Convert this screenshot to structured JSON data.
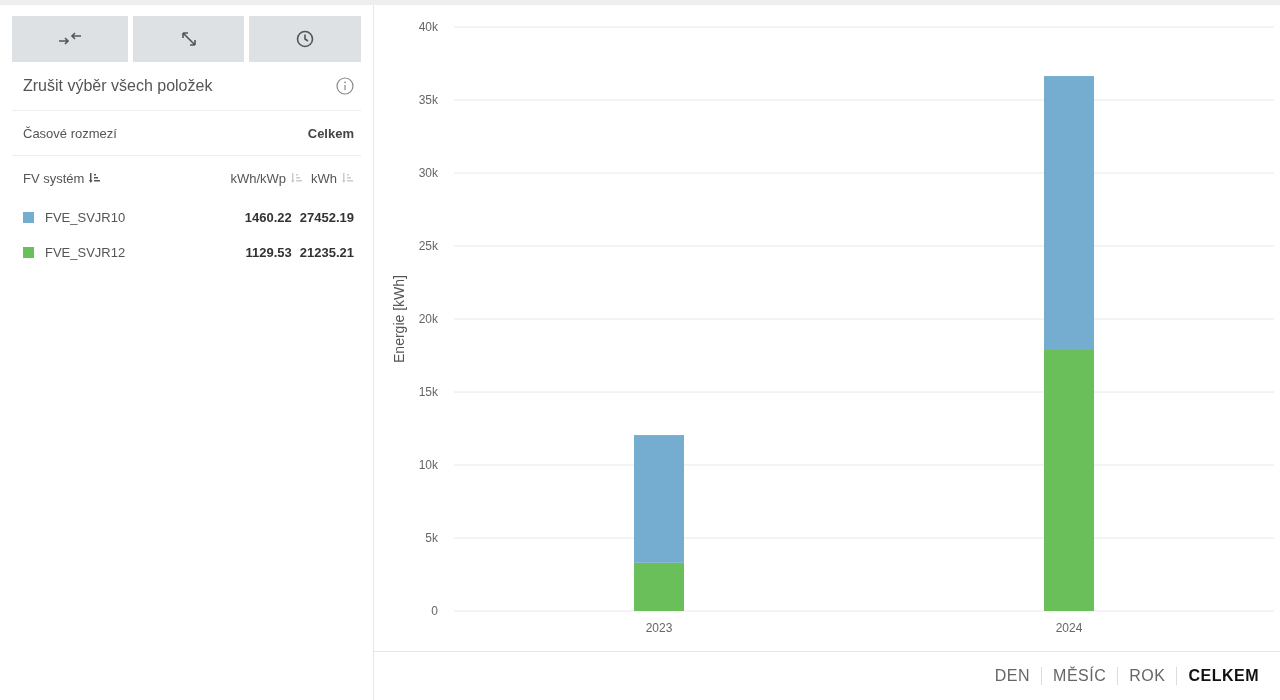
{
  "toolbar": {
    "buttons": [
      {
        "kind": "collapse"
      },
      {
        "kind": "expand"
      },
      {
        "kind": "history"
      }
    ]
  },
  "deselect_all": {
    "label": "Zrušit výběr všech položek"
  },
  "time_range": {
    "label": "Časové rozmezí",
    "value": "Celkem"
  },
  "table": {
    "columns": [
      {
        "label": "FV systém",
        "sorted": true
      },
      {
        "label": "kWh/kWp",
        "sorted": false
      },
      {
        "label": "kWh",
        "sorted": false
      }
    ],
    "rows": [
      {
        "name": "FVE_SVJR10",
        "color": "#74adcf",
        "yield": "1460.22",
        "energy": "27452.19"
      },
      {
        "name": "FVE_SVJR12",
        "color": "#6abf5a",
        "yield": "1129.53",
        "energy": "21235.21"
      }
    ]
  },
  "chart": {
    "chart_data": {
      "type": "bar",
      "stacked": true,
      "ylabel": "Energie [kWh]",
      "categories": [
        "2023",
        "2024"
      ],
      "grid": true,
      "series": [
        {
          "color": "#6abf5a",
          "values": [
            3300,
            17940
          ]
        },
        {
          "color": "#74adcf",
          "values": [
            8750,
            18700
          ]
        }
      ],
      "ylim": [
        0,
        40000
      ],
      "yticks": [
        {
          "value": 0,
          "label": "0"
        },
        {
          "value": 5000,
          "label": "5k"
        },
        {
          "value": 10000,
          "label": "10k"
        },
        {
          "value": 15000,
          "label": "15k"
        },
        {
          "value": 20000,
          "label": "20k"
        },
        {
          "value": 25000,
          "label": "25k"
        },
        {
          "value": 30000,
          "label": "30k"
        },
        {
          "value": 35000,
          "label": "35k"
        },
        {
          "value": 40000,
          "label": "40k"
        }
      ]
    }
  },
  "periods": [
    {
      "label": "DEN",
      "selected": false
    },
    {
      "label": "MĚSÍC",
      "selected": false
    },
    {
      "label": "ROK",
      "selected": false
    },
    {
      "label": "CELKEM",
      "selected": true
    }
  ]
}
